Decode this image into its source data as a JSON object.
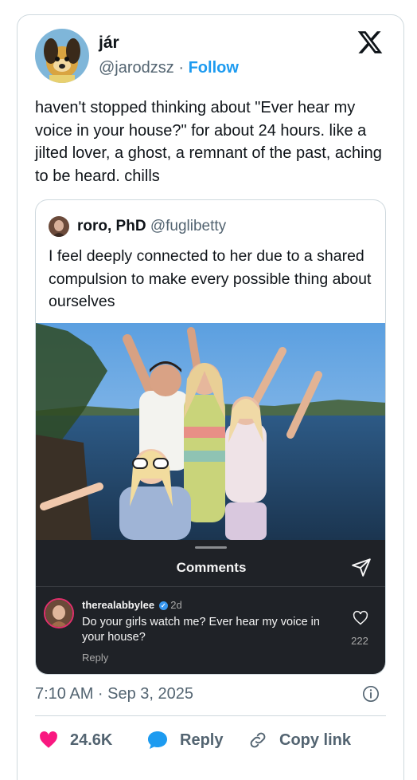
{
  "tweet": {
    "author_name": "jár",
    "author_handle": "@jarodzsz",
    "separator": "·",
    "follow_label": "Follow",
    "text": "haven't stopped thinking about \"Ever hear my voice in your house?\" for about 24 hours. like a jilted lover, a ghost, a remnant of the past, aching to be heard. chills",
    "timestamp": "7:10 AM · Sep 3, 2025"
  },
  "quoted_tweet": {
    "author_name": "roro, PhD",
    "author_handle": "@fuglibetty",
    "text": "I feel deeply connected to her due to a shared compulsion to make every possible thing about ourselves"
  },
  "instagram_panel": {
    "title": "Comments",
    "comment_user": "therealabbylee",
    "comment_age": "2d",
    "comment_text": "Do your girls watch me? Ever hear my voice in your house?",
    "reply_label": "Reply",
    "like_count": "222"
  },
  "actions": {
    "like_count": "24.6K",
    "reply_label": "Reply",
    "copy_label": "Copy link"
  },
  "icons": {
    "x_logo": "x-logo-icon",
    "verified": "verified-badge-icon",
    "send": "send-icon",
    "heart_outline": "heart-outline-icon",
    "info": "info-icon",
    "heart": "heart-icon",
    "reply": "reply-bubble-icon",
    "link": "link-icon"
  },
  "colors": {
    "like_pink": "#f91880",
    "reply_blue": "#1d9bf0",
    "follow_blue": "#1d9bf0",
    "ig_panel_bg": "#1f2227"
  }
}
